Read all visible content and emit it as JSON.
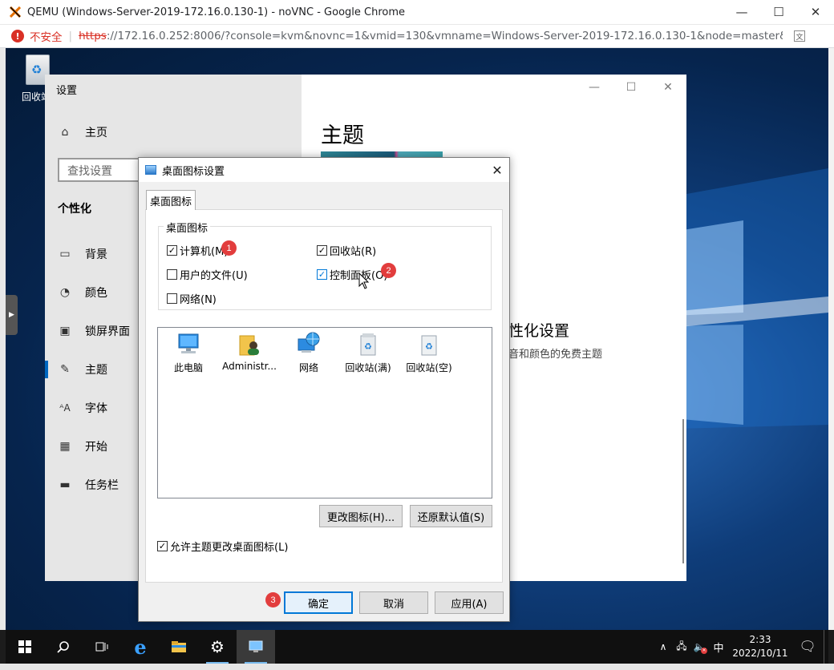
{
  "browser": {
    "title": "QEMU (Windows-Server-2019-172.16.0.130-1) - noVNC - Google Chrome",
    "insecure_label": "不安全",
    "url_scheme": "https",
    "url_rest": "://172.16.0.252:8006/?console=kvm&novnc=1&vmid=130&vmname=Windows-Server-2019-172.16.0.130-1&node=master&r...",
    "minimize": "—",
    "maximize": "☐",
    "close": "✕"
  },
  "desktop": {
    "recycle_label": "回收站"
  },
  "settings": {
    "window_title": "设置",
    "home": "主页",
    "search_placeholder": "查找设置",
    "section": "个性化",
    "nav": [
      "背景",
      "颜色",
      "锁屏界面",
      "主题",
      "字体",
      "开始",
      "任务栏"
    ],
    "selected_nav": "主题",
    "page_title": "主题",
    "related_heading": "性化设置",
    "related_text": "音和颜色的免费主题"
  },
  "dialog": {
    "title": "桌面图标设置",
    "close": "✕",
    "tab": "桌面图标",
    "group_legend": "桌面图标",
    "checkboxes": {
      "computer": {
        "label": "计算机(M)",
        "checked": true
      },
      "recycle": {
        "label": "回收站(R)",
        "checked": true
      },
      "user_files": {
        "label": "用户的文件(U)",
        "checked": false
      },
      "control_panel": {
        "label": "控制面板(O)",
        "checked": true
      },
      "network": {
        "label": "网络(N)",
        "checked": false
      }
    },
    "icons": [
      "此电脑",
      "Administr...",
      "网络",
      "回收站(满)",
      "回收站(空)"
    ],
    "change_icon": "更改图标(H)...",
    "restore_default": "还原默认值(S)",
    "allow_themes": {
      "label": "允许主题更改桌面图标(L)",
      "checked": true
    },
    "ok": "确定",
    "cancel": "取消",
    "apply": "应用(A)"
  },
  "annotations": {
    "badge1": "1",
    "badge2": "2",
    "badge3": "3"
  },
  "taskbar": {
    "ime": "中",
    "time": "2:33",
    "date": "2022/10/11"
  },
  "colors": {
    "accent": "#0078d7",
    "badge": "#e23d3d",
    "insecure": "#d93025"
  }
}
